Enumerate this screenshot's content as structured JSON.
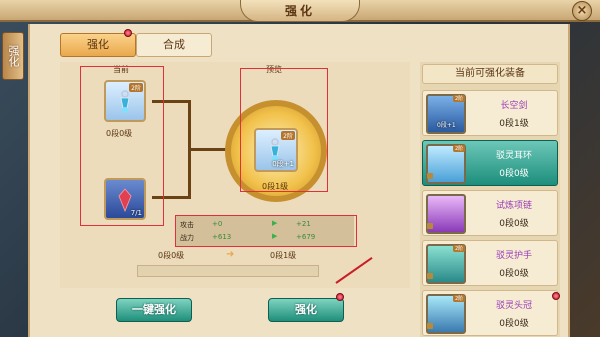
{
  "window": {
    "title": "强化",
    "close_icon": "×"
  },
  "side_tab": {
    "label": "强化"
  },
  "tabs": [
    {
      "label": "强化",
      "active": true
    },
    {
      "label": "合成",
      "active": false
    }
  ],
  "current": {
    "heading": "当前",
    "main_item": {
      "badge": "2阶",
      "level": "0段0级"
    },
    "material": {
      "count": "7/1"
    }
  },
  "preview": {
    "heading": "预览",
    "item": {
      "badge": "2阶",
      "level_tag": "0段+1"
    },
    "level": "0段1级"
  },
  "stats": {
    "attack_label": "攻击",
    "attack_now": "+0",
    "attack_next": "+21",
    "power_label": "战力",
    "power_now": "+613",
    "power_next": "+679"
  },
  "progress": {
    "from": "0段0级",
    "to": "0段1级"
  },
  "buttons": {
    "auto": "一键强化",
    "enhance": "强化"
  },
  "equip_panel": {
    "title": "当前可强化装备",
    "items": [
      {
        "name": "长空剑",
        "level": "0段1级",
        "badge": "2阶",
        "tag": "0段+1",
        "name_color": "#9a3bb5"
      },
      {
        "name": "驳灵耳环",
        "level": "0段0级",
        "badge": "2阶",
        "tag": "",
        "name_color": "#ffffff"
      },
      {
        "name": "试炼项链",
        "level": "0段0级",
        "badge": "",
        "tag": "",
        "name_color": "#9a3bb5"
      },
      {
        "name": "驳灵护手",
        "level": "0段0级",
        "badge": "2阶",
        "tag": "",
        "name_color": "#9a3bb5"
      },
      {
        "name": "驳灵头冠",
        "level": "0段0级",
        "badge": "2阶",
        "tag": "",
        "name_color": "#9a3bb5"
      }
    ]
  },
  "colors": {
    "accent": "#e9a84c",
    "teal": "#1f8f7a",
    "highlight_red": "#e0303a"
  }
}
